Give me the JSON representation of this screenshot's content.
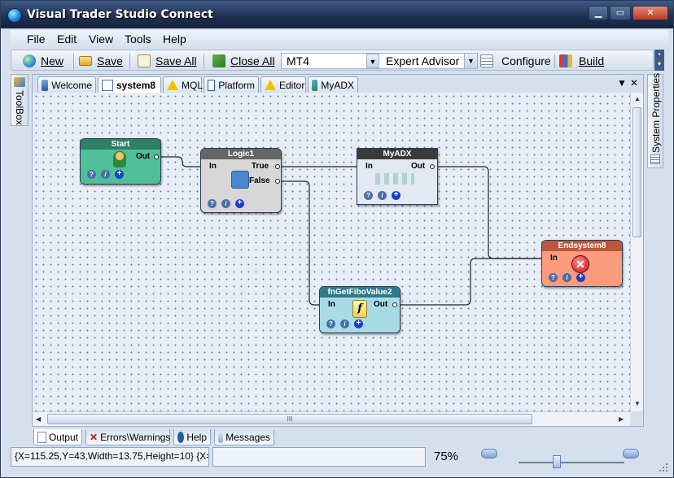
{
  "window": {
    "title": "Visual Trader Studio Connect",
    "min": "▁",
    "max": "▭",
    "close": "✕"
  },
  "menu": [
    "File",
    "Edit",
    "View",
    "Tools",
    "Help"
  ],
  "toolbar": {
    "new": "New",
    "save": "Save",
    "save_all": "Save All",
    "close_all": "Close All",
    "platform_value": "MT4",
    "type_value": "Expert Advisor",
    "configure": "Configure",
    "build": "Build"
  },
  "side": {
    "toolbox": "ToolBox",
    "system_properties": "System Properties"
  },
  "tabs": [
    {
      "label": "Welcome"
    },
    {
      "label": "system8",
      "active": true
    },
    {
      "label": "MQL"
    },
    {
      "label": "Platform"
    },
    {
      "label": "Editor"
    },
    {
      "label": "MyADX"
    }
  ],
  "tab_controls": {
    "menu": "▼",
    "close": "✕"
  },
  "nodes": {
    "start": {
      "title": "Start",
      "out": "Out",
      "color": "#4fbf9a",
      "header": "#2f7f64"
    },
    "logic": {
      "title": "Logic1",
      "in": "In",
      "true": "True",
      "false": "False",
      "color": "#d7d7d7",
      "header": "#666666"
    },
    "myadx": {
      "title": "MyADX",
      "in": "In",
      "out": "Out",
      "color": "#e2e9f3",
      "header": "#3a3a3a"
    },
    "end": {
      "title": "Endsystem8",
      "in": "In",
      "color": "#fb9c7c",
      "header": "#b9583d"
    },
    "fibo": {
      "title": "fnGetFiboValue2",
      "in": "In",
      "out": "Out",
      "color": "#a9dbe7",
      "header": "#2f7a8d"
    }
  },
  "node_buttons": {
    "help": "?",
    "info": "i",
    "add": "+"
  },
  "scroll": {
    "grip": "III"
  },
  "bottom_tabs": [
    {
      "label": "Output",
      "active": true
    },
    {
      "label": "Errors\\Warnings"
    },
    {
      "label": "Help"
    },
    {
      "label": "Messages"
    }
  ],
  "status": {
    "coords": "{X=115.25,Y=43,Width=13.75,Height=10} {X=1...",
    "zoom": "75%"
  }
}
